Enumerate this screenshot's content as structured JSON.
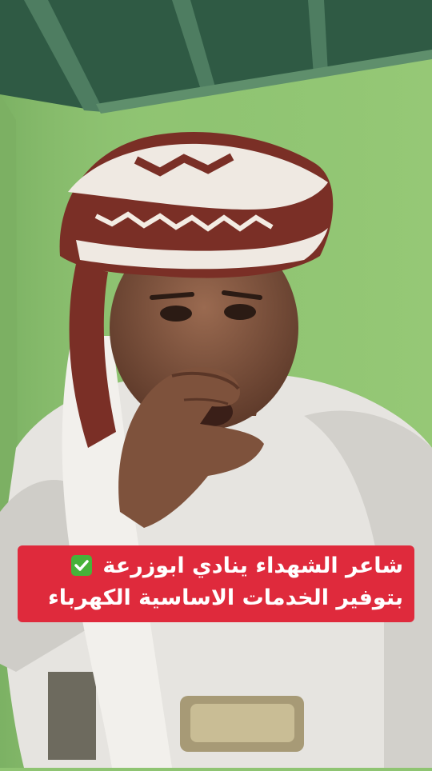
{
  "caption": {
    "line1": "شاعر الشهداء ينادي ابوزرعة",
    "line2": "بتوفير الخدمات الاساسية الكهرباء",
    "emoji": "check-mark-icon",
    "background_color": "#df2a3c",
    "text_color": "#ffffff"
  },
  "scene": {
    "wall_color": "#8fc472",
    "ceiling_color": "#2f5a44",
    "headwrap_colors": [
      "#7a2f26",
      "#efe9e2"
    ],
    "shirt_color": "#e6e4e0"
  }
}
